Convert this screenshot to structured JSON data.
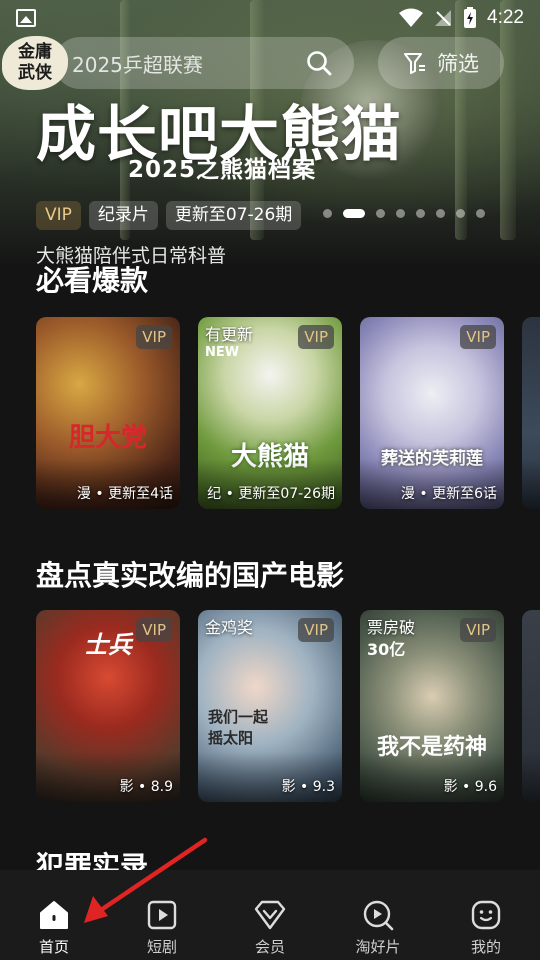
{
  "status_bar": {
    "time": "4:22"
  },
  "logo": {
    "line1": "金庸",
    "line2": "武侠"
  },
  "search": {
    "placeholder": "2025乒超联赛"
  },
  "filter": {
    "label": "筛选"
  },
  "hero": {
    "title": "成长吧大熊猫",
    "subtitle": "2025之熊猫档案",
    "tags": [
      "VIP",
      "纪录片",
      "更新至07-26期"
    ],
    "carousel": {
      "total": 8,
      "active": 2
    },
    "description": "大熊猫陪伴式日常科普"
  },
  "sections": [
    {
      "title": "必看爆款",
      "cards": [
        {
          "poster_text": "胆大党",
          "badge": "VIP",
          "corner_label": "",
          "corner_sub": "",
          "caption": "漫 • 更新至4话"
        },
        {
          "poster_text": "大熊猫",
          "badge": "VIP",
          "corner_label": "有更新",
          "corner_sub": "NEW",
          "caption": "纪 • 更新至07-26期"
        },
        {
          "poster_text": "葬送的芙莉莲",
          "badge": "VIP",
          "corner_label": "",
          "corner_sub": "",
          "caption": "漫 • 更新至6话"
        }
      ]
    },
    {
      "title": "盘点真实改编的国产电影",
      "cards": [
        {
          "poster_text": "士兵",
          "badge": "VIP",
          "corner_label": "",
          "corner_sub": "",
          "caption": "影 • 8.9"
        },
        {
          "poster_text": "我们一起摇太阳",
          "badge": "VIP",
          "corner_label": "金鸡奖",
          "corner_sub": "",
          "caption": "影 • 9.3"
        },
        {
          "poster_text": "我不是药神",
          "badge": "VIP",
          "corner_label": "票房破",
          "corner_sub": "30亿",
          "caption": "影 • 9.6"
        }
      ]
    },
    {
      "title": "犯罪实录"
    }
  ],
  "bottom_nav": [
    {
      "label": "首页",
      "icon": "home-icon",
      "active": true
    },
    {
      "label": "短剧",
      "icon": "play-square-icon",
      "active": false
    },
    {
      "label": "会员",
      "icon": "vip-diamond-icon",
      "active": false
    },
    {
      "label": "淘好片",
      "icon": "discover-icon",
      "active": false
    },
    {
      "label": "我的",
      "icon": "profile-face-icon",
      "active": false
    }
  ],
  "colors": {
    "accent_red": "#d6282c",
    "vip_gold": "#e3c487",
    "background": "#141414"
  }
}
